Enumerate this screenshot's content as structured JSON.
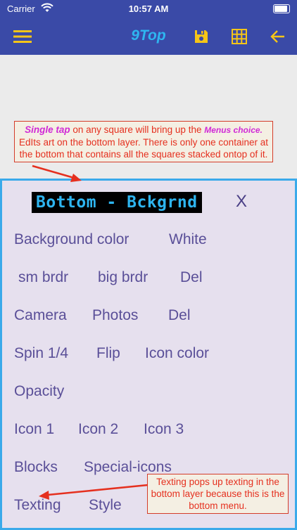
{
  "status": {
    "carrier": "Carrier",
    "time": "10:57 AM"
  },
  "appbar": {
    "title": "9Top"
  },
  "callout_top": {
    "em1": "Single tap",
    "t1": " on any square will bring up the ",
    "em2": "Menus choice.",
    "t2": " EdIts art on the bottom layer. There is only one container at the bottom that contains all the squares stacked ontop of it."
  },
  "menu": {
    "title": "Bottom - Bckgrnd",
    "close": "X",
    "items": {
      "bg_color": "Background color",
      "white": "White",
      "sm_brdr": "sm brdr",
      "big_brdr": "big brdr",
      "del1": "Del",
      "camera": "Camera",
      "photos": "Photos",
      "del2": "Del",
      "spin": "Spin 1/4",
      "flip": "Flip",
      "icon_color": "Icon color",
      "opacity": "Opacity",
      "icon1": "Icon 1",
      "icon2": "Icon 2",
      "icon3": "Icon 3",
      "blocks": "Blocks",
      "special_icons": "Special-icons",
      "texting": "Texting",
      "style": "Style"
    }
  },
  "callout_bottom": {
    "text": "Texting pops up texting in the bottom layer because this is the bottom menu."
  },
  "colors": {
    "bar": "#3a4aa7",
    "accent": "#f5c518",
    "title": "#2eb5f0",
    "menu_text": "#5a4f98",
    "callout": "#e5301f"
  }
}
